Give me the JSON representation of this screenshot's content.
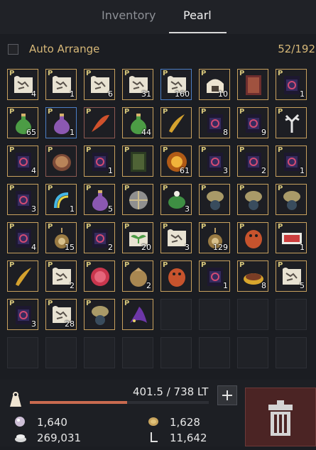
{
  "tabs": [
    {
      "label": "Inventory",
      "active": false
    },
    {
      "label": "Pearl",
      "active": true
    }
  ],
  "toolbar": {
    "auto_arrange_label": "Auto Arrange",
    "capacity": "52/192",
    "auto_arrange_checked": false
  },
  "colors": {
    "gold_border": "#c8a15e",
    "text_gold": "#d7b878",
    "weight_fill": "#c96a4f",
    "trash_bg": "#4b2424"
  },
  "slots": [
    {
      "icon": "map-scroll-icon",
      "qty": "4"
    },
    {
      "icon": "map-scroll-icon",
      "qty": "1"
    },
    {
      "icon": "map-scroll-icon",
      "qty": "6"
    },
    {
      "icon": "map-scroll-icon",
      "qty": "31"
    },
    {
      "icon": "map-scroll-icon",
      "qty": "160",
      "sel": "blue"
    },
    {
      "icon": "armor-helmet-icon",
      "qty": "10"
    },
    {
      "icon": "red-book-icon",
      "qty": ""
    },
    {
      "icon": "dark-banner-icon",
      "qty": "1"
    },
    {
      "icon": "green-potion-icon",
      "qty": "65"
    },
    {
      "icon": "purple-potion-icon",
      "qty": "1",
      "sel": "blue"
    },
    {
      "icon": "feather-icon",
      "qty": "",
      "sel": "red"
    },
    {
      "icon": "green-potion-icon",
      "qty": "44"
    },
    {
      "icon": "golden-horn-icon",
      "qty": ""
    },
    {
      "icon": "dark-banner-icon",
      "qty": "8"
    },
    {
      "icon": "dark-banner-icon",
      "qty": "9"
    },
    {
      "icon": "white-coral-icon",
      "qty": ""
    },
    {
      "icon": "dark-banner-icon",
      "qty": "4"
    },
    {
      "icon": "bowl-icon",
      "qty": "",
      "sel": "red"
    },
    {
      "icon": "dark-banner-icon",
      "qty": "1"
    },
    {
      "icon": "green-book-icon",
      "qty": ""
    },
    {
      "icon": "orange-orb-icon",
      "qty": "61"
    },
    {
      "icon": "dark-banner-icon",
      "qty": "3"
    },
    {
      "icon": "dark-banner-icon",
      "qty": "2"
    },
    {
      "icon": "dark-banner-icon",
      "qty": "1"
    },
    {
      "icon": "dark-banner-icon",
      "qty": "3"
    },
    {
      "icon": "rainbow-item-icon",
      "qty": "1"
    },
    {
      "icon": "purple-potion-icon",
      "qty": "5"
    },
    {
      "icon": "sphere-lantern-icon",
      "qty": ""
    },
    {
      "icon": "turtle-icon",
      "qty": "3"
    },
    {
      "icon": "compass-icon",
      "qty": ""
    },
    {
      "icon": "compass-icon",
      "qty": ""
    },
    {
      "icon": "compass-icon",
      "qty": ""
    },
    {
      "icon": "dark-banner-icon",
      "qty": "4"
    },
    {
      "icon": "pendant-icon",
      "qty": "15"
    },
    {
      "icon": "dark-banner-icon",
      "qty": "2"
    },
    {
      "icon": "sprout-scroll-icon",
      "qty": "20"
    },
    {
      "icon": "map-scroll-icon",
      "qty": "3"
    },
    {
      "icon": "pendant-icon",
      "qty": "129"
    },
    {
      "icon": "red-costume-icon",
      "qty": ""
    },
    {
      "icon": "coupon-icon",
      "qty": "1"
    },
    {
      "icon": "golden-horn-icon",
      "qty": ""
    },
    {
      "icon": "map-scroll-icon",
      "qty": "2"
    },
    {
      "icon": "red-plume-icon",
      "qty": ""
    },
    {
      "icon": "pouch-icon",
      "qty": "2"
    },
    {
      "icon": "red-costume-icon",
      "qty": ""
    },
    {
      "icon": "dark-banner-icon",
      "qty": "1"
    },
    {
      "icon": "food-bowl-icon",
      "qty": "8"
    },
    {
      "icon": "map-scroll-icon",
      "qty": "5"
    },
    {
      "icon": "dark-banner-icon",
      "qty": "3"
    },
    {
      "icon": "map-scroll-icon",
      "qty": "28"
    },
    {
      "icon": "compass-icon",
      "qty": ""
    },
    {
      "icon": "wizard-hat-icon",
      "qty": ""
    },
    {
      "icon": "",
      "qty": "",
      "empty": true
    },
    {
      "icon": "",
      "qty": "",
      "empty": true
    },
    {
      "icon": "",
      "qty": "",
      "empty": true
    },
    {
      "icon": "",
      "qty": "",
      "empty": true
    },
    {
      "icon": "",
      "qty": "",
      "empty": true
    },
    {
      "icon": "",
      "qty": "",
      "empty": true
    },
    {
      "icon": "",
      "qty": "",
      "empty": true
    },
    {
      "icon": "",
      "qty": "",
      "empty": true
    },
    {
      "icon": "",
      "qty": "",
      "empty": true
    },
    {
      "icon": "",
      "qty": "",
      "empty": true
    },
    {
      "icon": "",
      "qty": "",
      "empty": true
    },
    {
      "icon": "",
      "qty": "",
      "empty": true
    }
  ],
  "weight": {
    "text": "401.5 / 738 LT",
    "fraction": 0.544
  },
  "currency": {
    "pearls": "1,640",
    "silver": "269,031",
    "coins": "1,628",
    "loyalty": "11,642"
  }
}
